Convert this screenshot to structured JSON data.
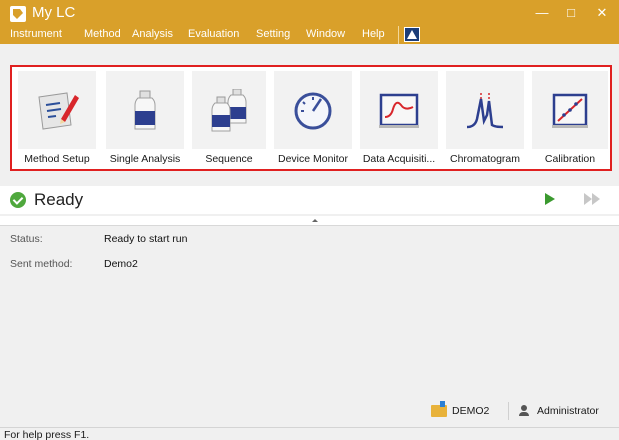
{
  "window": {
    "title": "My LC",
    "controls": [
      "minimize",
      "maximize",
      "close"
    ]
  },
  "menu": {
    "items": [
      "Instrument",
      "Method",
      "Analysis",
      "Evaluation",
      "Setting",
      "Window",
      "Help"
    ]
  },
  "toolbar": {
    "items": [
      {
        "label": "Method Setup",
        "icon": "method-setup-icon"
      },
      {
        "label": "Single Analysis",
        "icon": "single-analysis-icon"
      },
      {
        "label": "Sequence",
        "icon": "sequence-icon"
      },
      {
        "label": "Device Monitor",
        "icon": "device-monitor-icon"
      },
      {
        "label": "Data Acquisiti...",
        "icon": "data-acquisition-icon"
      },
      {
        "label": "Chromatogram",
        "icon": "chromatogram-icon"
      },
      {
        "label": "Calibration",
        "icon": "calibration-icon"
      }
    ]
  },
  "status": {
    "state": "Ready",
    "rows": [
      {
        "label": "Status:",
        "value": "Ready to start run"
      },
      {
        "label": "Sent method:",
        "value": "Demo2"
      }
    ]
  },
  "info": {
    "project": "DEMO2",
    "user": "Administrator"
  },
  "footer": {
    "help": "For help press F1."
  },
  "colors": {
    "titlebar": "#d9a02a",
    "highlight_border": "#e02020",
    "ready_green": "#4fa83d"
  }
}
